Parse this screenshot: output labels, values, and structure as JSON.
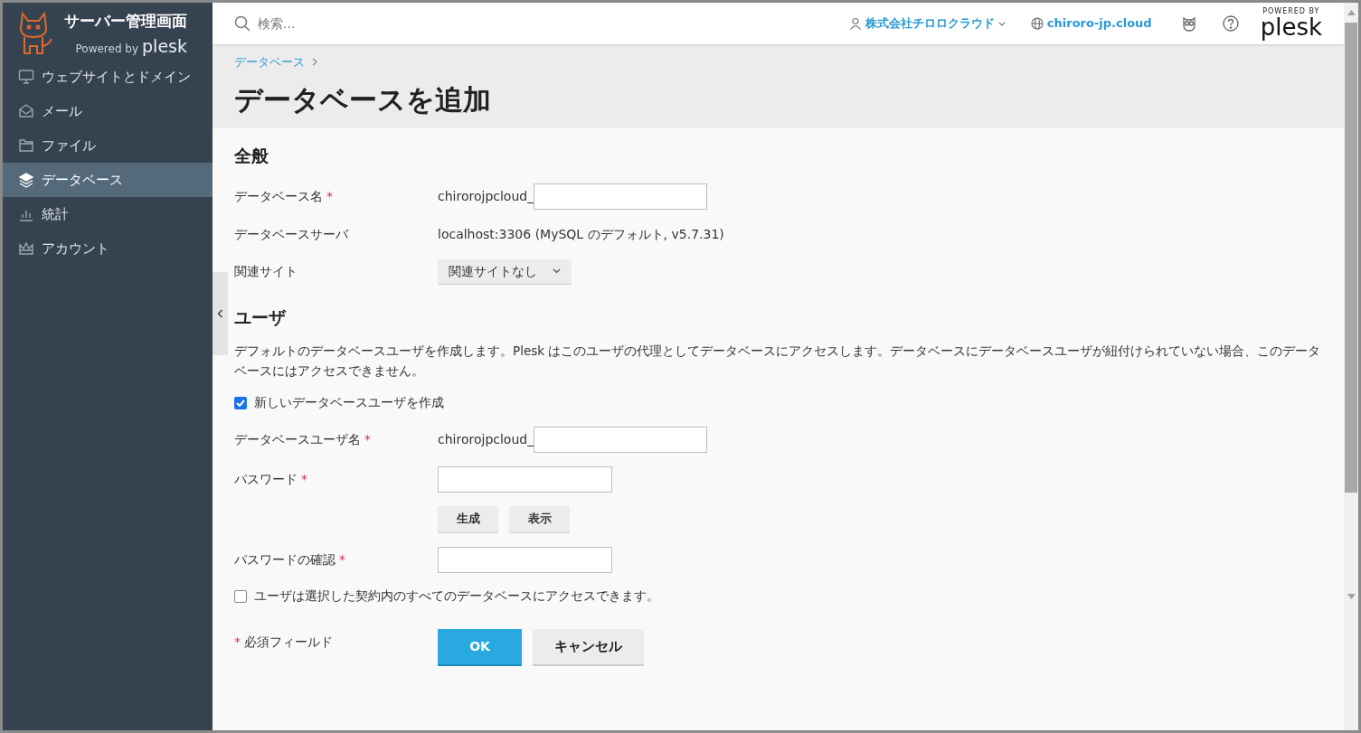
{
  "brand": {
    "title": "サーバー管理画面",
    "powered_by": "Powered by",
    "logo": "plesk"
  },
  "sidebar": {
    "items": [
      {
        "label": "ウェブサイトとドメイン",
        "selected": false
      },
      {
        "label": "メール",
        "selected": false
      },
      {
        "label": "ファイル",
        "selected": false
      },
      {
        "label": "データベース",
        "selected": true
      },
      {
        "label": "統計",
        "selected": false
      },
      {
        "label": "アカウント",
        "selected": false
      }
    ]
  },
  "topbar": {
    "search": {
      "placeholder": "検索..."
    },
    "account": "株式会社チロロクラウド",
    "domain": "chiroro-jp.cloud",
    "logo_caption": "POWERED BY",
    "logo": "plesk"
  },
  "breadcrumb": [
    "データベース"
  ],
  "title": "データベースを追加",
  "required_mark": "*",
  "general": {
    "heading": "全般",
    "fields": [
      {
        "kind": "prefixed",
        "label": "データベース名",
        "required": true,
        "prefix": "chirorojpcloud_"
      },
      {
        "kind": "text",
        "label": "データベースサーバ",
        "required": false,
        "value": "localhost:3306 (MySQL のデフォルト, v5.7.31)"
      },
      {
        "kind": "select",
        "label": "関連サイト",
        "required": false,
        "value": "関連サイトなし"
      }
    ]
  },
  "user": {
    "heading": "ユーザ",
    "description": "デフォルトのデータベースユーザを作成します。Plesk はこのユーザの代理としてデータベースにアクセスします。データベースにデータベースユーザが紐付けられていない場合、このデータベースにはアクセスできません。",
    "create_user": {
      "label": "新しいデータベースユーザを作成",
      "checked": true
    },
    "fields": [
      {
        "kind": "prefixed",
        "label": "データベースユーザ名",
        "required": true,
        "prefix": "chirorojpcloud_"
      },
      {
        "kind": "input",
        "label": "パスワード",
        "required": true
      },
      {
        "kind": "buttons",
        "buttons": [
          "生成",
          "表示"
        ]
      },
      {
        "kind": "input",
        "label": "パスワードの確認",
        "required": true
      }
    ],
    "all_access": {
      "label": "ユーザは選択した契約内のすべてのデータベースにアクセスできます。",
      "checked": false
    }
  },
  "footer": {
    "note": "必須フィールド",
    "ok": "OK",
    "cancel": "キャンセル"
  }
}
